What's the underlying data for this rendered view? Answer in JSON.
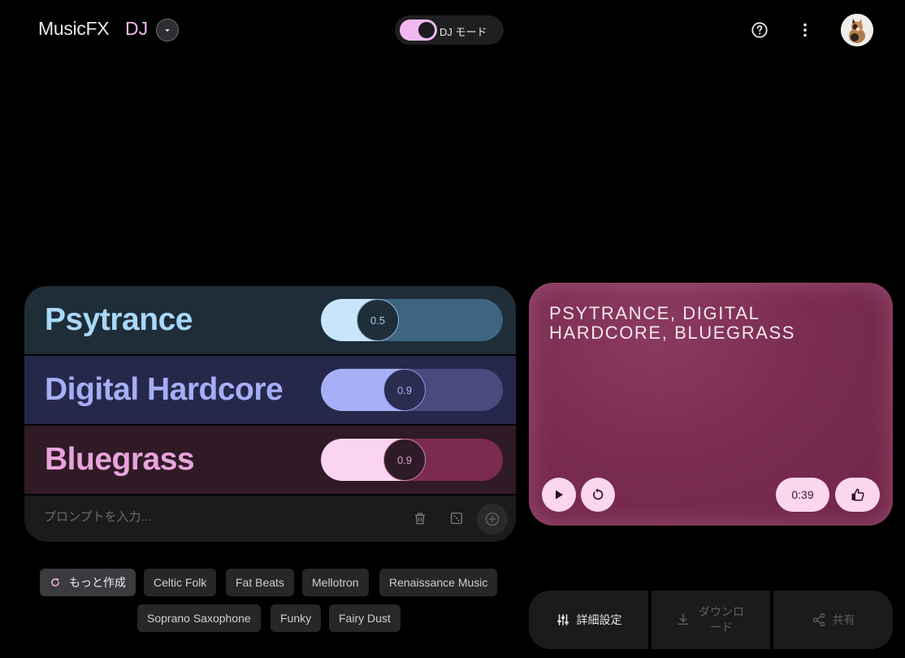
{
  "header": {
    "brand": "MusicFX",
    "brand_accent": "DJ",
    "mode_label": "DJ モード",
    "mode_on": true,
    "help_icon": "help-circle-icon",
    "menu_icon": "more-vert-icon"
  },
  "prompts": [
    {
      "label": "Psytrance",
      "weight": "0.5",
      "level": 0.5,
      "color": "#a9d8fa"
    },
    {
      "label": "Digital Hardcore",
      "weight": "0.9",
      "level": 0.9,
      "color": "#a6aef6"
    },
    {
      "label": "Bluegrass",
      "weight": "0.9",
      "level": 0.9,
      "color": "#e8a3dc"
    }
  ],
  "prompt_input": {
    "placeholder": "プロンプトを入力..."
  },
  "suggestions": {
    "more_label": "もっと作成",
    "chips": [
      "Celtic Folk",
      "Fat Beats",
      "Mellotron",
      "Renaissance Music",
      "Soprano Saxophone",
      "Funky",
      "Fairy Dust"
    ]
  },
  "player": {
    "title": "PSYTRANCE, DIGITAL HARDCORE, BLUEGRASS",
    "time": "0:39"
  },
  "actions": {
    "settings_label": "詳細設定",
    "download_label": "ダウンロード",
    "share_label": "共有"
  }
}
